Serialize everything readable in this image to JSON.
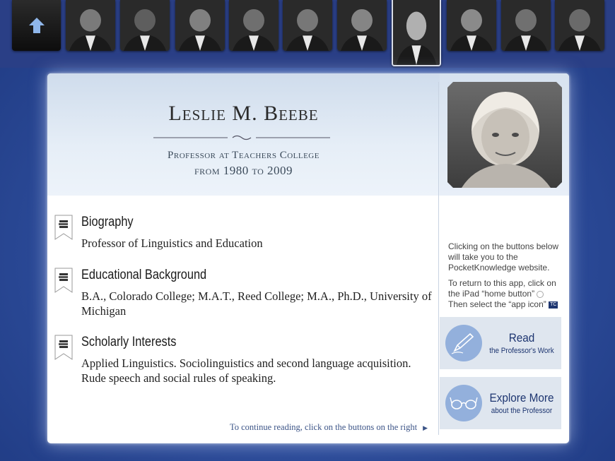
{
  "strip": {
    "home_icon": "up-arrow-home-icon",
    "portraits": [
      {
        "tone": "#7a7a7a"
      },
      {
        "tone": "#5e5e5e"
      },
      {
        "tone": "#808080"
      },
      {
        "tone": "#6f6f6f"
      },
      {
        "tone": "#777777"
      },
      {
        "tone": "#858585"
      },
      {
        "tone": "#b0b0b0",
        "active": true
      },
      {
        "tone": "#8a8a8a"
      },
      {
        "tone": "#707070"
      },
      {
        "tone": "#6a6a6a"
      }
    ]
  },
  "profile": {
    "name": "Leslie M. Beebe",
    "title_line1": "Professor at Teachers College",
    "title_line2": "from 1980 to 2009"
  },
  "sections": [
    {
      "title": "Biography",
      "body": "Professor of Linguistics and Education",
      "icon": "books-ribbon-icon"
    },
    {
      "title": "Educational Background",
      "body": "B.A., Colorado College; M.A.T., Reed College; M.A., Ph.D., University of Michigan",
      "icon": "books-ribbon-icon"
    },
    {
      "title": "Scholarly Interests",
      "body": "Applied Linguistics. Sociolinguistics and second language acquisition. Rude speech and social rules of speaking.",
      "icon": "books-ribbon-icon"
    }
  ],
  "continue_text": "To continue reading, click on the buttons on the right",
  "info": {
    "line1": "Clicking on the buttons below will take you to the PocketKnowledge website.",
    "line2": "To return to this app, click on the iPad “home button”",
    "line3": "Then select the “app icon”",
    "app_icon_label": "TC"
  },
  "buttons": {
    "read": {
      "main": "Read",
      "sub": "the Professor's Work",
      "icon": "pen-icon"
    },
    "explore": {
      "main": "Explore More",
      "sub": "about the Professor",
      "icon": "glasses-icon"
    }
  },
  "colors": {
    "accent": "#1d3570",
    "button_bg": "#dfe6ef",
    "circle": "#93b0dc",
    "background": "#2f4f9e"
  }
}
